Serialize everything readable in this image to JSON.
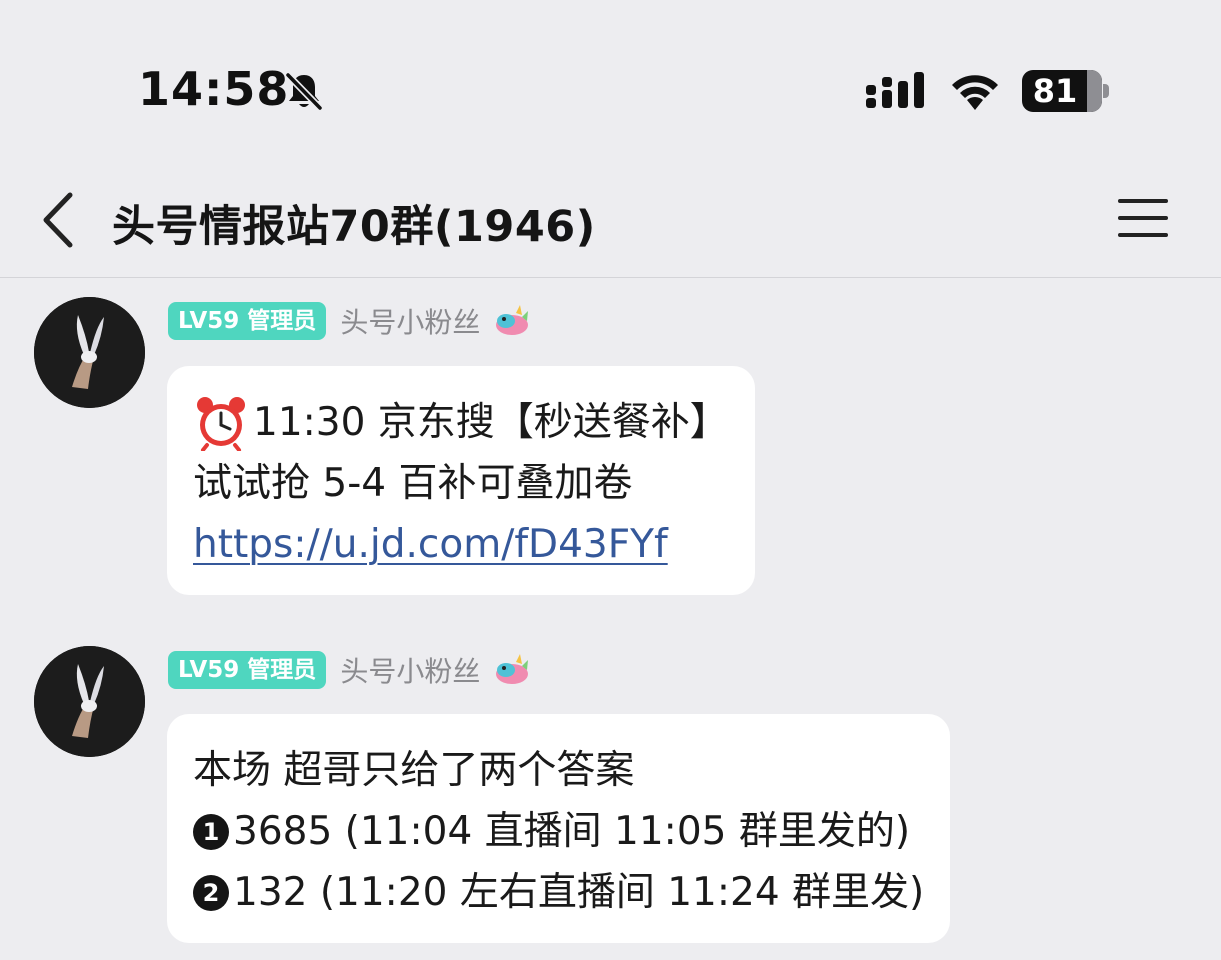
{
  "status_bar": {
    "time": "14:58",
    "battery_percent": 81,
    "battery_label": "81",
    "icons": [
      "bell-slash-icon",
      "signal-icon",
      "wifi-icon",
      "battery-icon"
    ]
  },
  "nav": {
    "title": "头号情报站70群(1946)",
    "back_icon": "chevron-left-icon",
    "menu_icon": "hamburger-menu-icon"
  },
  "messages": [
    {
      "badge": "LV59 管理员",
      "sender": "头号小粉丝",
      "sender_icon": "dragon-icon",
      "lines": [
        {
          "emoji": "alarm-clock-icon",
          "text": "11:30 京东搜【秒送餐补】"
        },
        {
          "text": "试试抢 5-4 百补可叠加卷"
        },
        {
          "link": "https://u.jd.com/fD43FYf"
        }
      ]
    },
    {
      "badge": "LV59 管理员",
      "sender": "头号小粉丝",
      "sender_icon": "dragon-icon",
      "lines": [
        {
          "text": "本场 超哥只给了两个答案"
        },
        {
          "marker": "1",
          "text": "3685 (11:04 直播间 11:05 群里发的)"
        },
        {
          "marker": "2",
          "text": "132 (11:20 左右直播间 11:24 群里发)"
        }
      ]
    }
  ],
  "colors": {
    "background": "#EDEDF0",
    "badge": "#4FD6BF",
    "link": "#35589A",
    "bubble": "#FFFFFF"
  }
}
